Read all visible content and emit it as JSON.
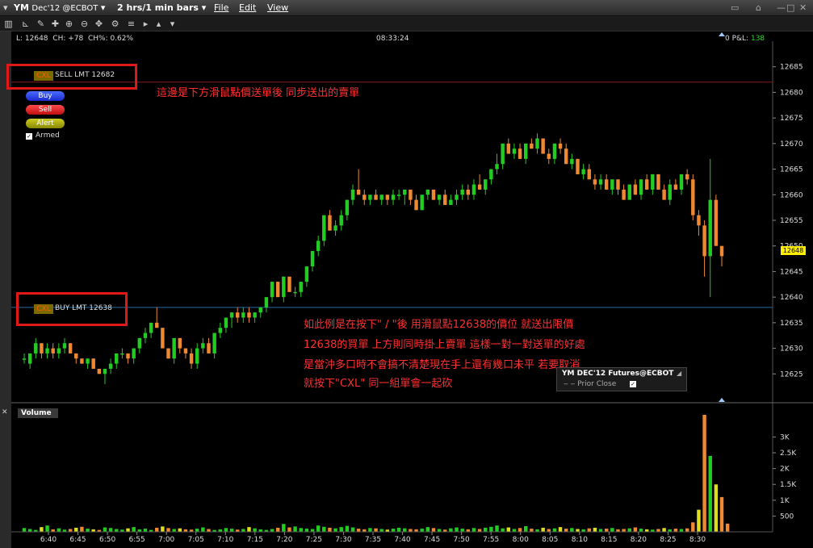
{
  "titlebar": {
    "symbol": "YM",
    "contract": "Dec'12 @ECBOT",
    "period": "2 hrs/1 min bars",
    "menu": [
      "File",
      "Edit",
      "View"
    ]
  },
  "header": {
    "last": "L: 12648",
    "change": "CH: +78",
    "change_pct": "CH%: 0.62%",
    "time": "08:33:24",
    "position": "0",
    "pnl_label": "P&L:",
    "pnl_value": "138"
  },
  "orders": {
    "sell": {
      "cxl": "CXL",
      "label": "SELL LMT 12682",
      "price": 12682
    },
    "buy": {
      "cxl": "CXL",
      "label": "BUY LMT 12638",
      "price": 12638
    }
  },
  "trade_panel": {
    "buy": "Buy",
    "sell": "Sell",
    "alert": "Alert",
    "armed": "Armed"
  },
  "annotations": {
    "top": "這邊是下方滑鼠點價送單後 同步送出的賣單",
    "bottom": [
      "如此例是在按下\" / \"後 用滑鼠點12638的價位 就送出限價",
      "12638的買單 上方則同時掛上賣單 這樣一對一對送單的好處",
      "是當沖多口時不會搞不清楚現在手上還有幾口未平 若要取消",
      "就按下\"CXL\" 同一組單會一起砍"
    ]
  },
  "legend": {
    "title": "YM DEC'12 Futures@ECBOT",
    "item": "Prior Close"
  },
  "volume_label": "Volume",
  "colors": {
    "up": "#22cc22",
    "down": "#ee8833",
    "order_line_sell": "#8b1a1a",
    "order_line_buy": "#2a6aa0",
    "annotation": "#ff3030",
    "last_price_bg": "#ffee00"
  },
  "chart_data": [
    {
      "type": "candlestick",
      "ylim": [
        12620,
        12690
      ],
      "y_ticks": [
        12625,
        12630,
        12635,
        12640,
        12645,
        12650,
        12655,
        12660,
        12665,
        12670,
        12675,
        12680,
        12685
      ],
      "last_price": 12648,
      "x_ticks": [
        "6:40",
        "6:45",
        "6:50",
        "6:55",
        "7:00",
        "7:05",
        "7:10",
        "7:15",
        "7:20",
        "7:25",
        "7:30",
        "7:35",
        "7:40",
        "7:45",
        "7:50",
        "7:55",
        "8:00",
        "8:05",
        "8:10",
        "8:15",
        "8:20",
        "8:25",
        "8:30"
      ],
      "candles_ohlc": [
        [
          12628,
          12629,
          12627,
          12628
        ],
        [
          12627,
          12629,
          12626,
          12629
        ],
        [
          12629,
          12632,
          12628,
          12631
        ],
        [
          12631,
          12631,
          12628,
          12629
        ],
        [
          12629,
          12631,
          12628,
          12630
        ],
        [
          12630,
          12631,
          12628,
          12629
        ],
        [
          12629,
          12631,
          12628,
          12630
        ],
        [
          12630,
          12632,
          12629,
          12631
        ],
        [
          12631,
          12631,
          12629,
          12629
        ],
        [
          12629,
          12629,
          12627,
          12628
        ],
        [
          12628,
          12628,
          12627,
          12627
        ],
        [
          12627,
          12628,
          12626,
          12628
        ],
        [
          12628,
          12628,
          12626,
          12626
        ],
        [
          12626,
          12626,
          12625,
          12625
        ],
        [
          12625,
          12626,
          12623,
          12626
        ],
        [
          12626,
          12628,
          12625,
          12627
        ],
        [
          12627,
          12629,
          12626,
          12629
        ],
        [
          12629,
          12630,
          12628,
          12629
        ],
        [
          12629,
          12629,
          12627,
          12628
        ],
        [
          12628,
          12630,
          12627,
          12630
        ],
        [
          12630,
          12632,
          12629,
          12632
        ],
        [
          12632,
          12634,
          12631,
          12633
        ],
        [
          12633,
          12635,
          12632,
          12635
        ],
        [
          12635,
          12638,
          12634,
          12634
        ],
        [
          12634,
          12634,
          12630,
          12630
        ],
        [
          12630,
          12630,
          12628,
          12628
        ],
        [
          12628,
          12632,
          12627,
          12632
        ],
        [
          12632,
          12632,
          12629,
          12630
        ],
        [
          12630,
          12630,
          12628,
          12629
        ],
        [
          12629,
          12630,
          12626,
          12627
        ],
        [
          12627,
          12631,
          12626,
          12630
        ],
        [
          12630,
          12632,
          12629,
          12631
        ],
        [
          12631,
          12632,
          12629,
          12629
        ],
        [
          12629,
          12633,
          12628,
          12633
        ],
        [
          12633,
          12635,
          12632,
          12634
        ],
        [
          12634,
          12636,
          12633,
          12636
        ],
        [
          12636,
          12637,
          12634,
          12637
        ],
        [
          12637,
          12638,
          12635,
          12636
        ],
        [
          12636,
          12638,
          12635,
          12637
        ],
        [
          12637,
          12638,
          12635,
          12636
        ],
        [
          12636,
          12637,
          12635,
          12637
        ],
        [
          12637,
          12638,
          12636,
          12638
        ],
        [
          12638,
          12640,
          12637,
          12640
        ],
        [
          12640,
          12643,
          12639,
          12643
        ],
        [
          12643,
          12643,
          12640,
          12640
        ],
        [
          12640,
          12644,
          12639,
          12644
        ],
        [
          12644,
          12644,
          12641,
          12641
        ],
        [
          12641,
          12642,
          12640,
          12641
        ],
        [
          12641,
          12643,
          12640,
          12643
        ],
        [
          12643,
          12646,
          12642,
          12646
        ],
        [
          12646,
          12649,
          12645,
          12649
        ],
        [
          12649,
          12652,
          12648,
          12651
        ],
        [
          12651,
          12656,
          12650,
          12656
        ],
        [
          12656,
          12657,
          12653,
          12653
        ],
        [
          12653,
          12655,
          12652,
          12654
        ],
        [
          12654,
          12657,
          12653,
          12656
        ],
        [
          12656,
          12659,
          12655,
          12659
        ],
        [
          12659,
          12662,
          12658,
          12661
        ],
        [
          12661,
          12665,
          12660,
          12660
        ],
        [
          12660,
          12661,
          12658,
          12659
        ],
        [
          12659,
          12660,
          12658,
          12660
        ],
        [
          12660,
          12661,
          12659,
          12659
        ],
        [
          12659,
          12660,
          12658,
          12660
        ],
        [
          12660,
          12660,
          12658,
          12659
        ],
        [
          12659,
          12661,
          12658,
          12660
        ],
        [
          12660,
          12661,
          12659,
          12660
        ],
        [
          12660,
          12661,
          12658,
          12661
        ],
        [
          12661,
          12661,
          12658,
          12659
        ],
        [
          12659,
          12660,
          12657,
          12657
        ],
        [
          12657,
          12660,
          12657,
          12660
        ],
        [
          12660,
          12661,
          12659,
          12661
        ],
        [
          12661,
          12661,
          12659,
          12659
        ],
        [
          12659,
          12660,
          12658,
          12660
        ],
        [
          12660,
          12661,
          12658,
          12658
        ],
        [
          12658,
          12660,
          12658,
          12659
        ],
        [
          12659,
          12661,
          12658,
          12660
        ],
        [
          12660,
          12662,
          12659,
          12661
        ],
        [
          12661,
          12662,
          12659,
          12660
        ],
        [
          12660,
          12663,
          12659,
          12662
        ],
        [
          12662,
          12664,
          12661,
          12661
        ],
        [
          12661,
          12663,
          12660,
          12663
        ],
        [
          12663,
          12665,
          12662,
          12665
        ],
        [
          12665,
          12668,
          12664,
          12666
        ],
        [
          12666,
          12670,
          12665,
          12670
        ],
        [
          12670,
          12671,
          12668,
          12668
        ],
        [
          12668,
          12670,
          12667,
          12669
        ],
        [
          12669,
          12670,
          12667,
          12667
        ],
        [
          12667,
          12670,
          12666,
          12670
        ],
        [
          12670,
          12671,
          12669,
          12669
        ],
        [
          12669,
          12672,
          12668,
          12671
        ],
        [
          12671,
          12671,
          12668,
          12668
        ],
        [
          12668,
          12669,
          12666,
          12667
        ],
        [
          12667,
          12670,
          12666,
          12670
        ],
        [
          12670,
          12671,
          12668,
          12669
        ],
        [
          12669,
          12670,
          12666,
          12666
        ],
        [
          12666,
          12668,
          12665,
          12667
        ],
        [
          12667,
          12667,
          12664,
          12664
        ],
        [
          12664,
          12666,
          12663,
          12665
        ],
        [
          12665,
          12666,
          12663,
          12663
        ],
        [
          12663,
          12664,
          12661,
          12662
        ],
        [
          12662,
          12664,
          12661,
          12663
        ],
        [
          12663,
          12664,
          12661,
          12661
        ],
        [
          12661,
          12663,
          12660,
          12663
        ],
        [
          12663,
          12663,
          12660,
          12661
        ],
        [
          12661,
          12662,
          12659,
          12659
        ],
        [
          12659,
          12662,
          12659,
          12662
        ],
        [
          12662,
          12663,
          12660,
          12660
        ],
        [
          12660,
          12663,
          12659,
          12663
        ],
        [
          12663,
          12664,
          12661,
          12661
        ],
        [
          12661,
          12664,
          12660,
          12664
        ],
        [
          12664,
          12664,
          12661,
          12661
        ],
        [
          12661,
          12662,
          12659,
          12659
        ],
        [
          12659,
          12663,
          12658,
          12662
        ],
        [
          12662,
          12663,
          12661,
          12661
        ],
        [
          12661,
          12664,
          12660,
          12664
        ],
        [
          12664,
          12665,
          12662,
          12663
        ],
        [
          12663,
          12664,
          12655,
          12656
        ],
        [
          12656,
          12657,
          12652,
          12654
        ],
        [
          12654,
          12655,
          12644,
          12648
        ],
        [
          12648,
          12667,
          12640,
          12659
        ],
        [
          12659,
          12660,
          12650,
          12650
        ],
        [
          12650,
          12650,
          12646,
          12648
        ]
      ]
    },
    {
      "type": "bar",
      "title": "Volume",
      "ylim": [
        0,
        3700
      ],
      "y_ticks": [
        "500",
        "1K",
        "1.5K",
        "2K",
        "2.5K",
        "3K"
      ],
      "values": [
        120,
        90,
        60,
        150,
        200,
        80,
        110,
        70,
        90,
        130,
        160,
        100,
        80,
        60,
        140,
        120,
        90,
        70,
        110,
        150,
        80,
        100,
        60,
        130,
        170,
        120,
        90,
        110,
        80,
        70,
        100,
        140,
        90,
        60,
        80,
        120,
        100,
        70,
        90,
        150,
        110,
        80,
        60,
        90,
        130,
        250,
        140,
        170,
        120,
        100,
        90,
        200,
        160,
        130,
        110,
        150,
        190,
        140,
        100,
        80,
        120,
        110,
        90,
        70,
        100,
        130,
        110,
        90,
        80,
        100,
        150,
        120,
        90,
        70,
        110,
        140,
        100,
        80,
        120,
        90,
        130,
        160,
        200,
        110,
        140,
        90,
        120,
        180,
        100,
        80,
        130,
        90,
        110,
        150,
        100,
        120,
        90,
        80,
        110,
        130,
        90,
        100,
        120,
        80,
        90,
        110,
        140,
        100,
        80,
        70,
        90,
        120,
        80,
        100,
        90,
        110,
        300,
        700,
        3700,
        2400,
        1500,
        1100,
        260
      ]
    }
  ]
}
